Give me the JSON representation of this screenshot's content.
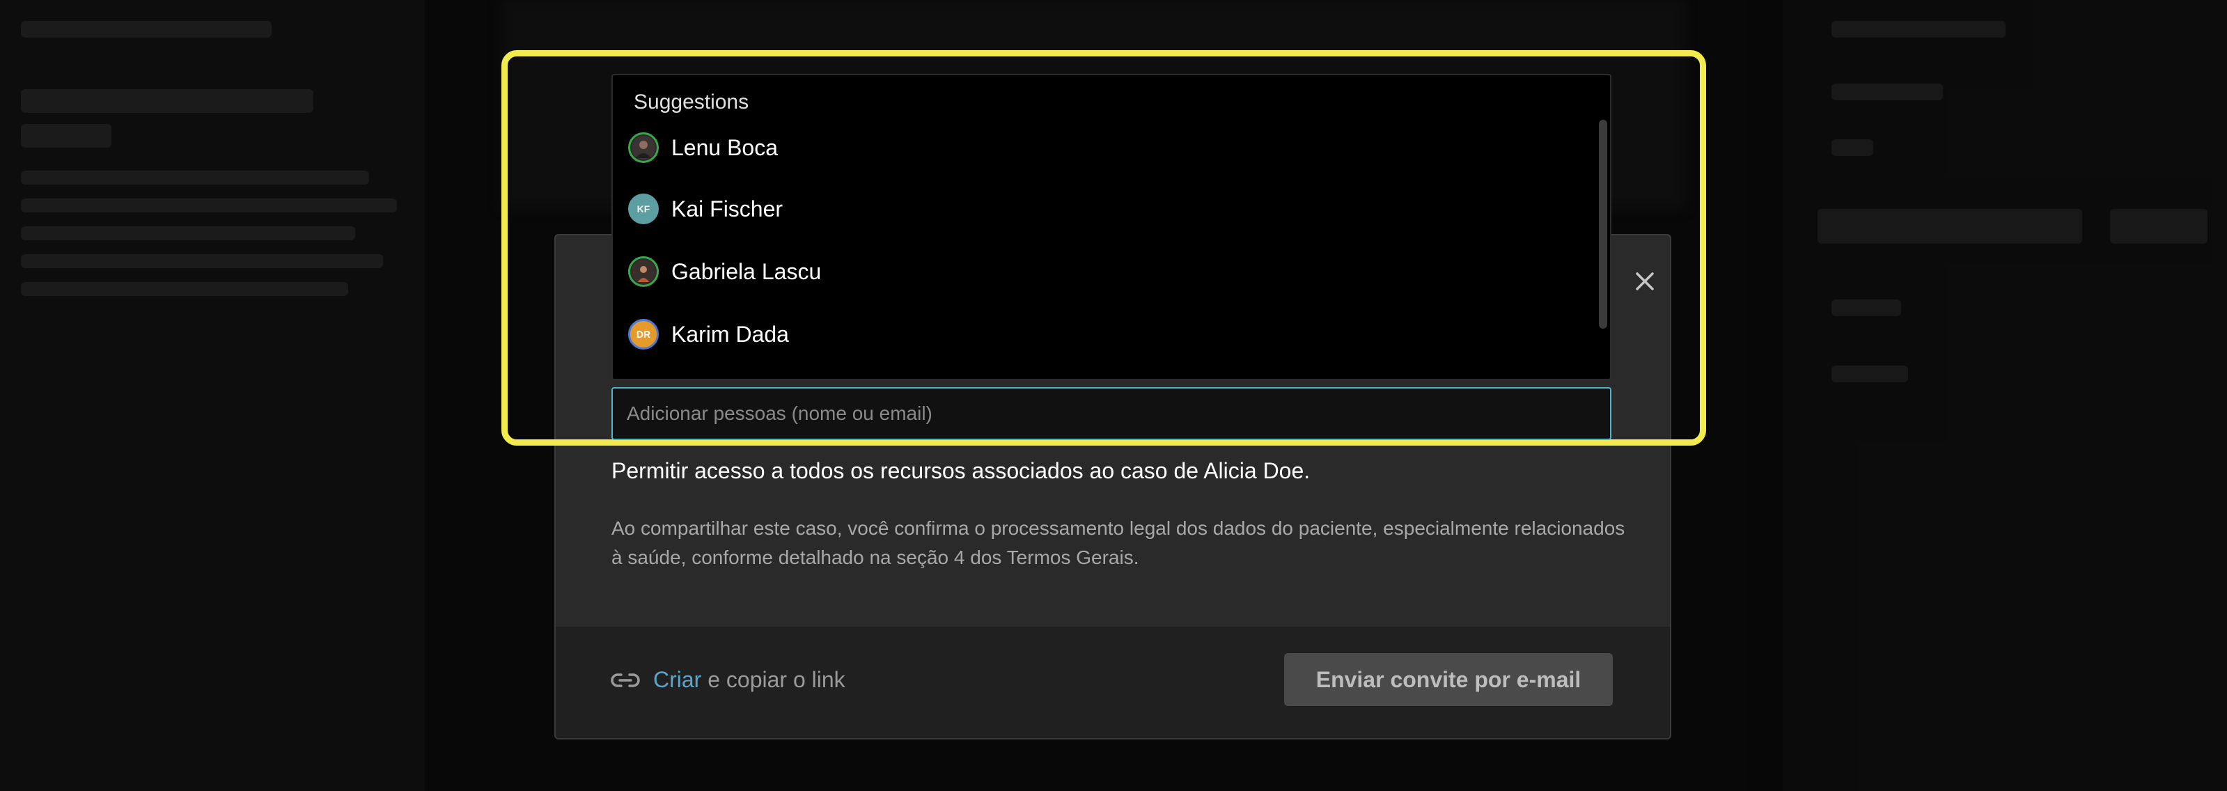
{
  "suggestions": {
    "title": "Suggestions",
    "items": [
      {
        "name": "Lenu Boca",
        "initials": ""
      },
      {
        "name": "Kai Fischer",
        "initials": "KF"
      },
      {
        "name": "Gabriela Lascu",
        "initials": ""
      },
      {
        "name": "Karim Dada",
        "initials": "DR"
      }
    ]
  },
  "input": {
    "placeholder": "Adicionar pessoas (nome ou email)"
  },
  "modal": {
    "access_text": "Permitir acesso a todos os recursos associados ao caso de Alicia Doe.",
    "legal_text": "Ao compartilhar este caso, você confirma o processamento legal dos dados do paciente, especialmente relacionados à saúde, conforme detalhado na seção 4 dos Termos Gerais.",
    "footer": {
      "create_label": "Criar",
      "copy_label": "e copiar o link",
      "send_label": "Enviar convite por e-mail"
    }
  },
  "colors": {
    "highlight": "#f3ea4e",
    "link": "#5da4c9",
    "input_border": "#4fb6cf"
  }
}
